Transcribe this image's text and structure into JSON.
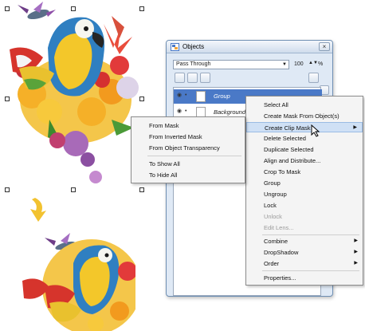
{
  "window": {
    "title": "Objects",
    "close_glyph": "×",
    "icon": "objects-icon"
  },
  "toolbar": {
    "blend_mode": "Pass Through",
    "opacity": "100",
    "opacity_unit": "%"
  },
  "object_list": {
    "rows": [
      {
        "label": "Group",
        "selected": true
      },
      {
        "label": "Background",
        "selected": false
      }
    ]
  },
  "context_menu": {
    "items": [
      {
        "label": "Select All",
        "enabled": true
      },
      {
        "label": "Create Mask From Object(s)",
        "enabled": true
      },
      {
        "label": "Create Clip Mask",
        "enabled": true,
        "has_submenu": true,
        "highlighted": true
      },
      {
        "label": "Delete Selected",
        "enabled": true
      },
      {
        "label": "Duplicate Selected",
        "enabled": true
      },
      {
        "label": "Align and Distribute...",
        "enabled": true
      },
      {
        "label": "Crop To Mask",
        "enabled": true
      },
      {
        "label": "Group",
        "enabled": true
      },
      {
        "label": "Ungroup",
        "enabled": true
      },
      {
        "label": "Lock",
        "enabled": true
      },
      {
        "label": "Unlock",
        "enabled": false
      },
      {
        "label": "Edit Lens...",
        "enabled": false
      },
      {
        "label": "Combine",
        "enabled": true,
        "has_submenu": true
      },
      {
        "label": "DropShadow",
        "enabled": true,
        "has_submenu": true
      },
      {
        "label": "Order",
        "enabled": true,
        "has_submenu": true
      },
      {
        "label": "Properties...",
        "enabled": true
      }
    ]
  },
  "sub_menu": {
    "items": [
      {
        "label": "From Mask"
      },
      {
        "label": "From Inverted Mask"
      },
      {
        "label": "From Object Transparency"
      },
      {
        "label": "To Show All"
      },
      {
        "label": "To Hide All"
      }
    ]
  },
  "colors": {
    "accent": "#4a79c7",
    "arrow": "#f2c230",
    "menu_highlight": "#cfe0f5"
  }
}
